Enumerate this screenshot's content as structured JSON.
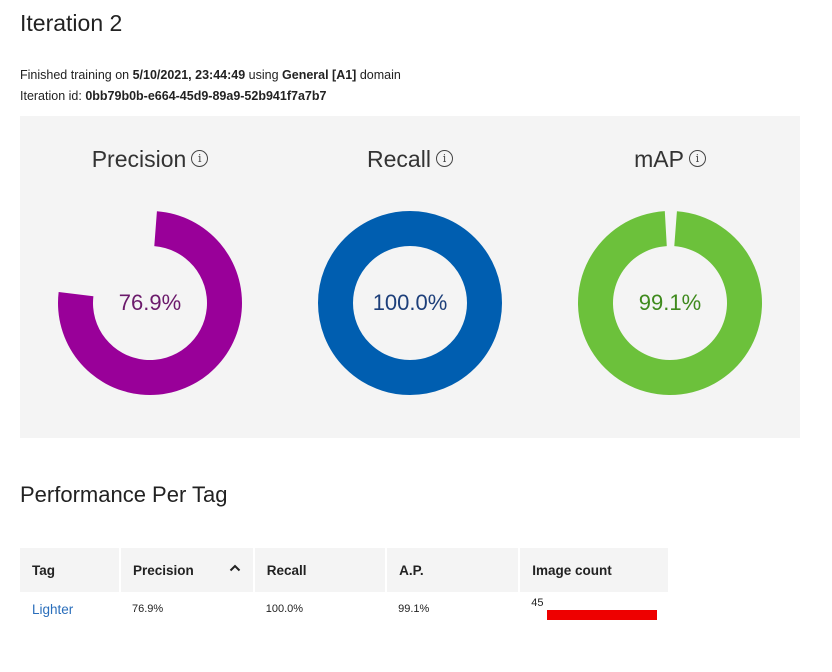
{
  "page": {
    "title": "Iteration 2",
    "meta": {
      "prefix": "Finished training on ",
      "date": "5/10/2021, 23:44:49",
      "using": " using ",
      "domain_name": "General [A1]",
      "domain_suffix": " domain",
      "iteration_id_label": "Iteration id: ",
      "iteration_id": "0bb79b0b-e664-45d9-89a9-52b941f7a7b7"
    }
  },
  "metrics": [
    {
      "label": "Precision",
      "value_text": "76.9%",
      "value": 76.9,
      "color": "#990099",
      "text_color": "#6b1a6b",
      "info_icon": "info-icon"
    },
    {
      "label": "Recall",
      "value_text": "100.0%",
      "value": 100.0,
      "color": "#005eb0",
      "text_color": "#1d3f7a",
      "info_icon": "info-icon"
    },
    {
      "label": "mAP",
      "value_text": "99.1%",
      "value": 99.1,
      "color": "#6cc13b",
      "text_color": "#3f8a1d",
      "info_icon": "info-icon"
    }
  ],
  "performance": {
    "title": "Performance Per Tag",
    "columns": [
      "Tag",
      "Precision",
      "Recall",
      "A.P.",
      "Image count"
    ],
    "sort_icon": "chevron-up-icon",
    "rows": [
      {
        "tag": "Lighter",
        "precision": "76.9%",
        "recall": "100.0%",
        "ap": "99.1%",
        "image_count": "45",
        "bar_color": "#ee0000"
      }
    ]
  }
}
